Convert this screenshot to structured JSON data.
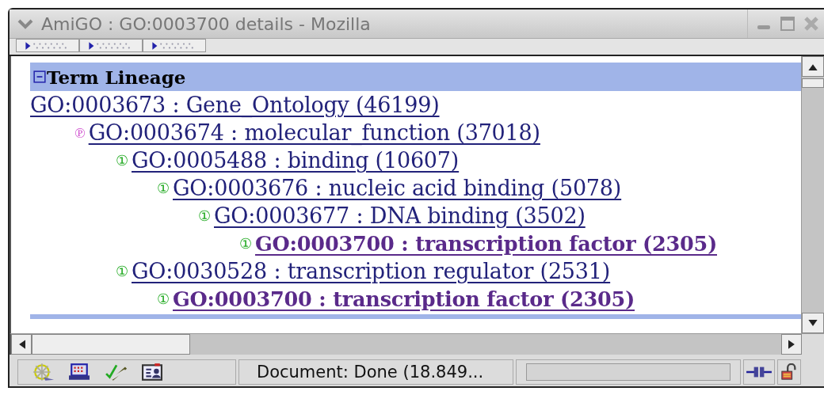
{
  "window": {
    "title": "AmiGO : GO:0003700 details - Mozilla"
  },
  "tab_strip": {
    "tabs": [
      {
        "selected": false
      },
      {
        "selected": false
      },
      {
        "selected": false
      }
    ]
  },
  "section": {
    "title": "Term Lineage",
    "expanded": true
  },
  "lineage": [
    {
      "text": "GO:0003673 : Gene_Ontology (46199)",
      "current": false,
      "children": [
        {
          "badge": "℗",
          "color": "#cc44cc",
          "text": "GO:0003674 : molecular_function (37018)",
          "current": false,
          "children": [
            {
              "badge": "①",
              "color": "#22aa22",
              "text": "GO:0005488 : binding (10607)",
              "current": false,
              "children": [
                {
                  "badge": "①",
                  "color": "#22aa22",
                  "text": "GO:0003676 : nucleic acid binding (5078)",
                  "current": false,
                  "children": [
                    {
                      "badge": "①",
                      "color": "#22aa22",
                      "text": "GO:0003677 : DNA binding (3502)",
                      "current": false,
                      "children": [
                        {
                          "badge": "①",
                          "color": "#22aa22",
                          "text": "GO:0003700 : transcription factor (2305)",
                          "current": true
                        }
                      ]
                    }
                  ]
                }
              ]
            },
            {
              "badge": "①",
              "color": "#22aa22",
              "text": "GO:0030528 : transcription regulator (2531)",
              "current": false,
              "children": [
                {
                  "badge": "①",
                  "color": "#22aa22",
                  "text": "GO:0003700 : transcription factor (2305)",
                  "current": true
                }
              ]
            }
          ]
        }
      ]
    }
  ],
  "status_bar": {
    "text": "Document: Done (18.849..."
  }
}
